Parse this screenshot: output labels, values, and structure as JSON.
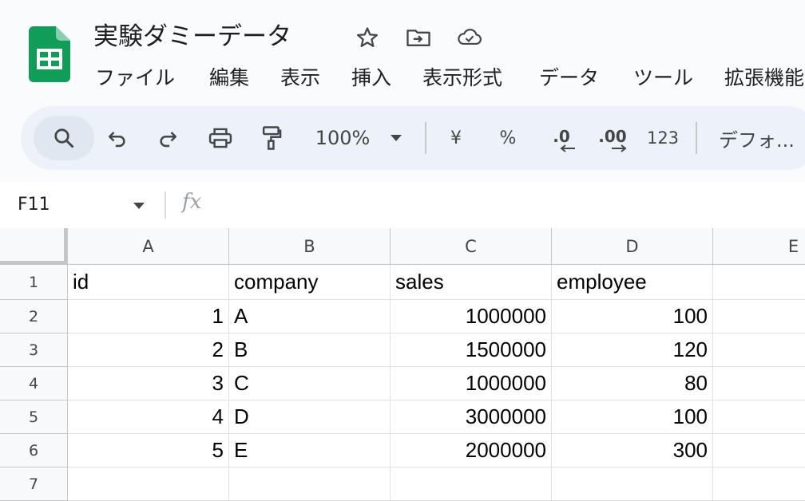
{
  "document": {
    "title": "実験ダミーデータ",
    "icons": [
      "star-icon",
      "move-to-folder-icon",
      "cloud-saved-icon"
    ]
  },
  "menu": [
    "ファイル",
    "編集",
    "表示",
    "挿入",
    "表示形式",
    "データ",
    "ツール",
    "拡張機能"
  ],
  "toolbar": {
    "zoom": "100%",
    "currency": "¥",
    "percent": "%",
    "decrease_decimal": ".0",
    "increase_decimal": ".00",
    "number_format": "123",
    "font": "デフォ..."
  },
  "formula_bar": {
    "cell_ref": "F11",
    "fx": "fx",
    "content": ""
  },
  "grid": {
    "columns": [
      "A",
      "B",
      "C",
      "D",
      "E"
    ],
    "rows": [
      "1",
      "2",
      "3",
      "4",
      "5",
      "6",
      "7"
    ],
    "cells": [
      [
        "id",
        "company",
        "sales",
        "employee",
        ""
      ],
      [
        "1",
        "A",
        "1000000",
        "100",
        ""
      ],
      [
        "2",
        "B",
        "1500000",
        "120",
        ""
      ],
      [
        "3",
        "C",
        "1000000",
        "80",
        ""
      ],
      [
        "4",
        "D",
        "3000000",
        "100",
        ""
      ],
      [
        "5",
        "E",
        "2000000",
        "300",
        ""
      ],
      [
        "",
        "",
        "",
        "",
        ""
      ]
    ]
  },
  "colors": {
    "sheets_green": "#0f9d58",
    "toolbar_bg": "#edf2fa",
    "grid_line": "#e1e1e1",
    "header_bg": "#f8f9fa"
  }
}
